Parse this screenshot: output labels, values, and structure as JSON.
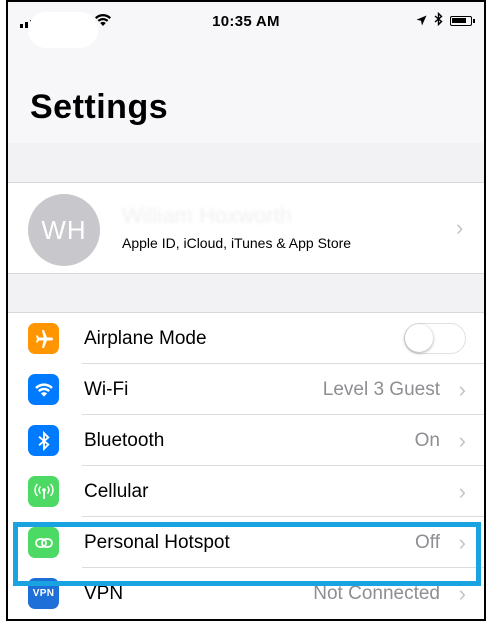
{
  "status_bar": {
    "time": "10:35 AM",
    "wifi_icon": "wifi-icon",
    "location_icon": "location-arrow-icon",
    "bluetooth_icon": "bluetooth-icon",
    "battery_icon": "battery-icon"
  },
  "header": {
    "title": "Settings"
  },
  "profile": {
    "initials": "WH",
    "name": "William Hoxworth",
    "subtitle": "Apple ID, iCloud, iTunes & App Store"
  },
  "settings": {
    "items": [
      {
        "label": "Airplane Mode",
        "value": "",
        "icon": "airplane-icon",
        "color": "#ff9500",
        "control": "toggle",
        "toggle_on": false
      },
      {
        "label": "Wi-Fi",
        "value": "Level 3 Guest",
        "icon": "wifi-icon",
        "color": "#007aff",
        "control": "chevron"
      },
      {
        "label": "Bluetooth",
        "value": "On",
        "icon": "bluetooth-icon",
        "color": "#007aff",
        "control": "chevron"
      },
      {
        "label": "Cellular",
        "value": "",
        "icon": "cellular-antenna-icon",
        "color": "#4cd964",
        "control": "chevron"
      },
      {
        "label": "Personal Hotspot",
        "value": "Off",
        "icon": "hotspot-link-icon",
        "color": "#4cd964",
        "control": "chevron"
      },
      {
        "label": "VPN",
        "value": "Not Connected",
        "icon": "vpn-icon",
        "icon_text": "VPN",
        "color": "#1f6fd8",
        "control": "chevron"
      }
    ]
  },
  "highlight_color": "#19a3e0"
}
